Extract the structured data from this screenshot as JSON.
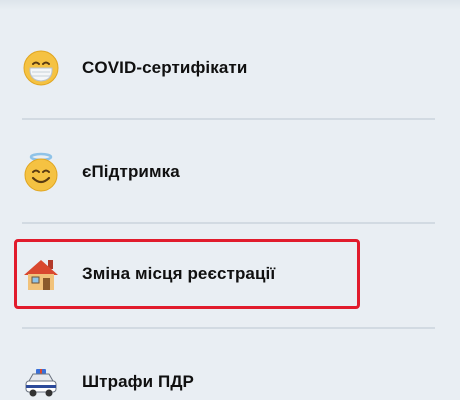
{
  "menu": {
    "items": [
      {
        "label": "COVID-сертифікати",
        "icon": "mask-face-icon"
      },
      {
        "label": "єПідтримка",
        "icon": "angel-face-icon"
      },
      {
        "label": "Зміна місця реєстрації",
        "icon": "house-icon",
        "highlighted": true
      },
      {
        "label": "Штрафи ПДР",
        "icon": "police-car-icon"
      }
    ]
  },
  "colors": {
    "background": "#e9eef3",
    "divider": "#d2dae2",
    "highlight": "#e11b2c",
    "text": "#101010"
  }
}
